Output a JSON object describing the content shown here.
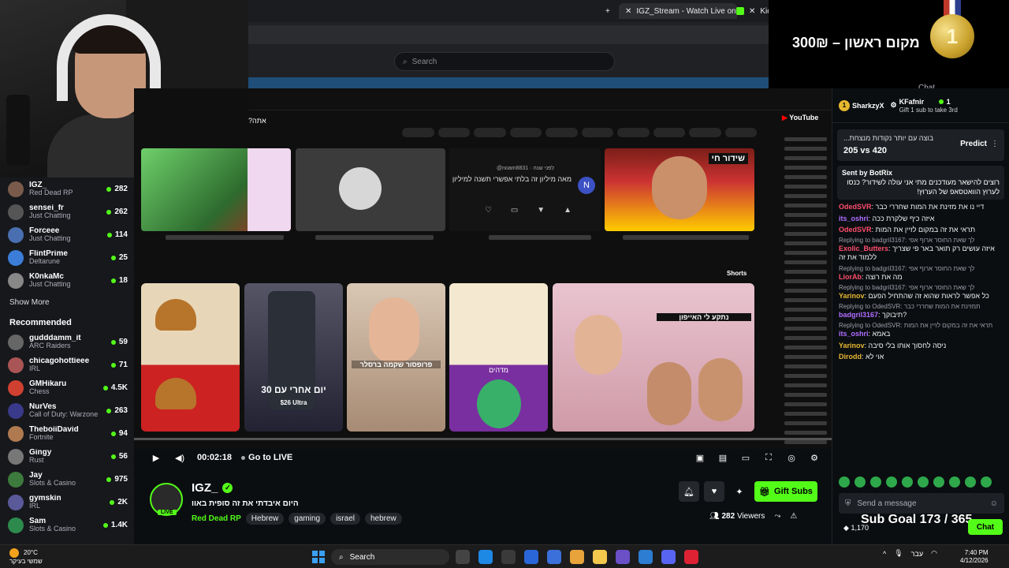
{
  "browser": {
    "tabs": [
      {
        "label": "IGZ_Stream - Watch Live on K"
      },
      {
        "label": "Kick"
      }
    ],
    "search_placeholder": "Search"
  },
  "overlay": {
    "prize_text": "300₪ – מקום ראשון",
    "medal_number": "1",
    "chat_label": "Chat"
  },
  "sidebar": {
    "following": [
      {
        "name": "IGZ_",
        "game": "Red Dead RP",
        "viewers": "282",
        "color": "#7a5b4b"
      },
      {
        "name": "sensei_fr",
        "game": "Just Chatting",
        "viewers": "262",
        "color": "#555"
      },
      {
        "name": "Forceee",
        "game": "Just Chatting",
        "viewers": "114",
        "color": "#4a6fb0"
      },
      {
        "name": "FlintPrime",
        "game": "Deltarune",
        "viewers": "25",
        "color": "#3b7dd8"
      },
      {
        "name": "K0nkaMc",
        "game": "Just Chatting",
        "viewers": "18",
        "color": "#888"
      }
    ],
    "show_more": "Show More",
    "recommended_title": "Recommended",
    "recommended": [
      {
        "name": "gudddamm_it",
        "game": "ARC Raiders",
        "viewers": "59",
        "color": "#666"
      },
      {
        "name": "chicagohottieee",
        "game": "IRL",
        "viewers": "71",
        "color": "#a55"
      },
      {
        "name": "GMHikaru",
        "game": "Chess",
        "viewers": "4.5K",
        "color": "#d04030"
      },
      {
        "name": "NurVes",
        "game": "Call of Duty: Warzone",
        "viewers": "263",
        "color": "#3a3a8a"
      },
      {
        "name": "TheboiiDavid",
        "game": "Fortnite",
        "viewers": "94",
        "color": "#b07a50"
      },
      {
        "name": "Gingy",
        "game": "Rust",
        "viewers": "56",
        "color": "#777"
      },
      {
        "name": "Jay",
        "game": "Slots & Casino",
        "viewers": "975",
        "color": "#3d7a3d"
      },
      {
        "name": "gymskin",
        "game": "IRL",
        "viewers": "2K",
        "color": "#5a5a9a"
      },
      {
        "name": "Sam",
        "game": "Slots & Casino",
        "viewers": "1.4K",
        "color": "#2d8a4d"
      }
    ]
  },
  "video": {
    "yt_question": "?אתה",
    "yt_logo": "YouTube",
    "comment_handle": "@noam8831 · לפני שנה",
    "comment_text": "מאה מיליון זה בלתי אפשרי תשנה למיליון",
    "comment_avatar": "N",
    "live_tag": "שידור חי",
    "shorts_label": "Shorts",
    "short_phone_text": "30 יום אחרי עם",
    "short_phone_sub": "$26 Ultra",
    "short_woman_caption": "פרופסור שקמה ברסלר",
    "short_egg_caption": "מדהים",
    "short_group_caption": "נתקע לי האייפון",
    "progress": 0.0
  },
  "controls": {
    "time": "00:02:18",
    "go_live": "Go to LIVE"
  },
  "channel": {
    "name": "IGZ_",
    "title": "היום איבדתי את זה סופית באוו",
    "category": "Red Dead RP",
    "tags": [
      "Hebrew",
      "gaming",
      "israel",
      "hebrew"
    ],
    "gift_label": "Gift Subs",
    "viewers": "282",
    "viewers_label": "Viewers",
    "live_badge": "LIVE"
  },
  "chat": {
    "gifters": [
      {
        "rank": "1",
        "name": "SharkzyX",
        "count": "1"
      },
      {
        "name": "KFafnir",
        "count": "1",
        "sub": "Gift 1 sub to take 3rd"
      }
    ],
    "prediction_question": "...בוצה עם יותר נקודות מנצחת",
    "prediction_vs": "205 vs 420",
    "predict_label": "Predict",
    "pinned_by": "Sent by BotRix",
    "pinned_text": "רוצים להישאר מעודכנים מתי אני עולה לשידור? כנסו לערוץ הוואטסאפ של הערוץ!",
    "messages": [
      {
        "user": "OdedSVR",
        "color": "#ff4d6d",
        "text": "דיי נו את מזינת את המות שחררי כבר"
      },
      {
        "user": "its_oshri",
        "color": "#b06cff",
        "text": "איזה כיף שלקרת ככה"
      },
      {
        "user": "OdedSVR",
        "color": "#ff4d6d",
        "text": "תראי את זה במקום לזיין את המות"
      },
      {
        "reply": "Replying to badgril3167: לך שאת החוסר ארוף אפי",
        "user": "Exolic_Butters",
        "color": "#ff4d6d",
        "text": "איזה עושים רק תואר באר פי שצריך ללמוד את זה"
      },
      {
        "reply": "Replying to badgril3167: לך שאת החוסר ארוף אפי",
        "user": "LiorAb",
        "color": "#ff4d6d",
        "text": "מה את רוצה"
      },
      {
        "reply": "Replying to badgril3167: לך שאת החוסר ארוף אפי",
        "user": "Yarinov",
        "color": "#e6b830",
        "text": "כל אפשר לראות שהוא זה שהתחיל הפעם"
      },
      {
        "reply": "Replying to OdedSVR: תמזינת את המות שחררי כבר",
        "user": "badgril3167",
        "color": "#b06cff",
        "text": "תיבוקך?"
      },
      {
        "reply": "Replying to OdedSVR: תראי את זה במקום לזיין את המות",
        "user": "its_oshri",
        "color": "#b06cff",
        "text": "באמא"
      },
      {
        "user": "Yarinov",
        "color": "#e6b830",
        "text": "ניסה לחסוך אותו בלי סיבה"
      },
      {
        "user": "Dirodd",
        "color": "#e6b830",
        "text": "אוי לא"
      }
    ],
    "input_placeholder": "Send a message",
    "sub_goal": "Sub Goal 173 / 365",
    "points": "1,170",
    "chat_button": "Chat"
  },
  "taskbar": {
    "temp": "20°C",
    "weather": "שמשי בעיקר",
    "search": "Search",
    "lang": "עבר",
    "time": "7:40 PM",
    "date": "4/12/2026"
  }
}
